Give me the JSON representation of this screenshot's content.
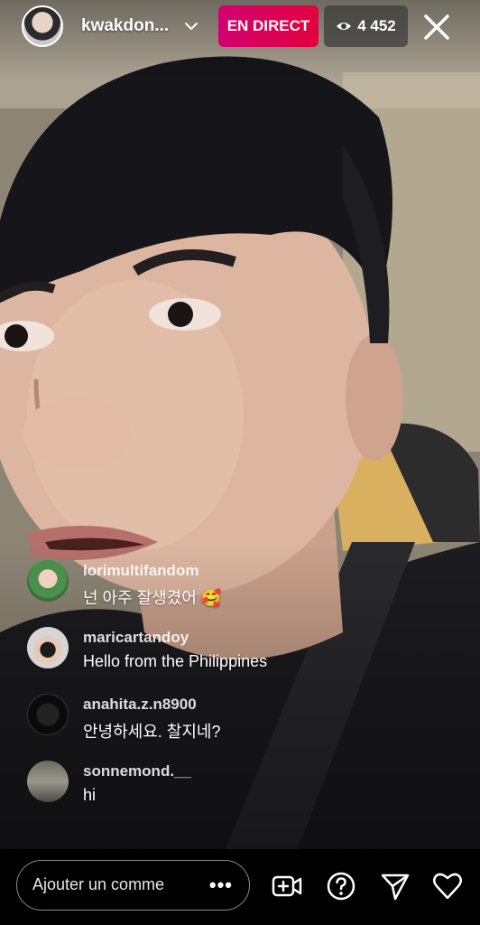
{
  "header": {
    "host_username": "kwakdon...",
    "live_label": "EN DIRECT",
    "viewer_count": "4 452"
  },
  "comments": [
    {
      "username": "lorimultifandom",
      "text": "넌 아주 잘생겼어 🥰"
    },
    {
      "username": "maricartandoy",
      "text": "Hello from the Philippines"
    },
    {
      "username": "anahita.z.n8900",
      "text": "안녕하세요.  찰지네?"
    },
    {
      "username": "sonnemond.__",
      "text": "hi"
    }
  ],
  "bottom_bar": {
    "comment_placeholder": "Ajouter un comme",
    "more_label": "•••"
  },
  "icons": [
    "chevron-down-icon",
    "eye-icon",
    "close-icon",
    "video-add-icon",
    "question-icon",
    "send-icon",
    "heart-icon"
  ],
  "colors": {
    "live_badge": "#e0005a",
    "viewer_badge_bg": "#3c3c3c"
  }
}
